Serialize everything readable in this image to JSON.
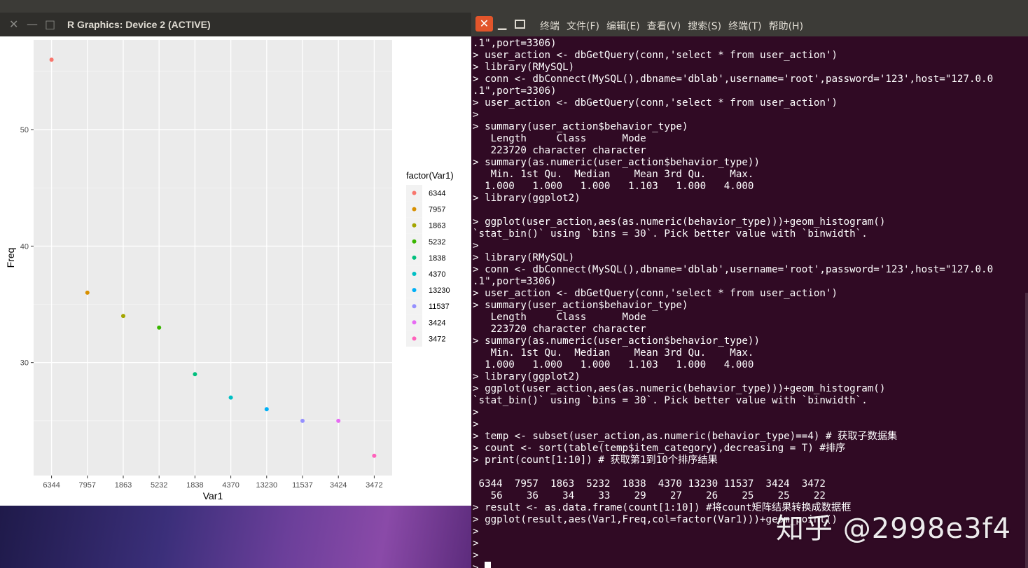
{
  "r_window": {
    "title": "R Graphics: Device 2 (ACTIVE)",
    "controls": [
      "✕",
      "—",
      "□"
    ]
  },
  "chart_data": {
    "type": "scatter",
    "categories": [
      "6344",
      "7957",
      "1863",
      "5232",
      "1838",
      "4370",
      "13230",
      "11537",
      "3424",
      "3472"
    ],
    "values": [
      56,
      36,
      34,
      33,
      29,
      27,
      26,
      25,
      25,
      22
    ],
    "xlabel": "Var1",
    "ylabel": "Freq",
    "yticks": [
      30,
      40,
      50
    ],
    "ylim": [
      20.3,
      57.7
    ],
    "grid": true,
    "legend": {
      "title": "factor(Var1)",
      "position": "right",
      "entries": [
        "6344",
        "7957",
        "1863",
        "5232",
        "1838",
        "4370",
        "13230",
        "11537",
        "3424",
        "3472"
      ]
    },
    "colors": [
      "#F8766D",
      "#D89000",
      "#A3A500",
      "#39B600",
      "#00BF7D",
      "#00BFC4",
      "#00B0F6",
      "#9590FF",
      "#E76BF3",
      "#FF62BC"
    ],
    "panel_bg": "#EBEBEB"
  },
  "terminal": {
    "menu": [
      "终端",
      "文件(F)",
      "编辑(E)",
      "查看(V)",
      "搜索(S)",
      "终端(T)",
      "帮助(H)"
    ],
    "lines": [
      ".1\",port=3306)",
      "> user_action <- dbGetQuery(conn,'select * from user_action')",
      "> library(RMySQL)",
      "> conn <- dbConnect(MySQL(),dbname='dblab',username='root',password='123',host=\"127.0.0",
      ".1\",port=3306)",
      "> user_action <- dbGetQuery(conn,'select * from user_action')",
      ">",
      "> summary(user_action$behavior_type)",
      "   Length     Class      Mode",
      "   223720 character character",
      "> summary(as.numeric(user_action$behavior_type))",
      "   Min. 1st Qu.  Median    Mean 3rd Qu.    Max.",
      "  1.000   1.000   1.000   1.103   1.000   4.000",
      "> library(ggplot2)",
      "",
      "> ggplot(user_action,aes(as.numeric(behavior_type)))+geom_histogram()",
      "`stat_bin()` using `bins = 30`. Pick better value with `binwidth`.",
      ">",
      "> library(RMySQL)",
      "> conn <- dbConnect(MySQL(),dbname='dblab',username='root',password='123',host=\"127.0.0",
      ".1\",port=3306)",
      "> user_action <- dbGetQuery(conn,'select * from user_action')",
      "> summary(user_action$behavior_type)",
      "   Length     Class      Mode",
      "   223720 character character",
      "> summary(as.numeric(user_action$behavior_type))",
      "   Min. 1st Qu.  Median    Mean 3rd Qu.    Max.",
      "  1.000   1.000   1.000   1.103   1.000   4.000",
      "> library(ggplot2)",
      "> ggplot(user_action,aes(as.numeric(behavior_type)))+geom_histogram()",
      "`stat_bin()` using `bins = 30`. Pick better value with `binwidth`.",
      ">",
      ">",
      "> temp <- subset(user_action,as.numeric(behavior_type)==4) # 获取子数据集",
      "> count <- sort(table(temp$item_category),decreasing = T) #排序",
      "> print(count[1:10]) # 获取第1到10个排序结果",
      "",
      " 6344  7957  1863  5232  1838  4370 13230 11537  3424  3472",
      "   56    36    34    33    29    27    26    25    25    22",
      "> result <- as.data.frame(count[1:10]) #将count矩阵结果转换成数据框",
      "> ggplot(result,aes(Var1,Freq,col=factor(Var1)))+geom_point()",
      ">",
      ">",
      ">",
      "> "
    ]
  },
  "watermark": "知乎 @2998e3f4"
}
